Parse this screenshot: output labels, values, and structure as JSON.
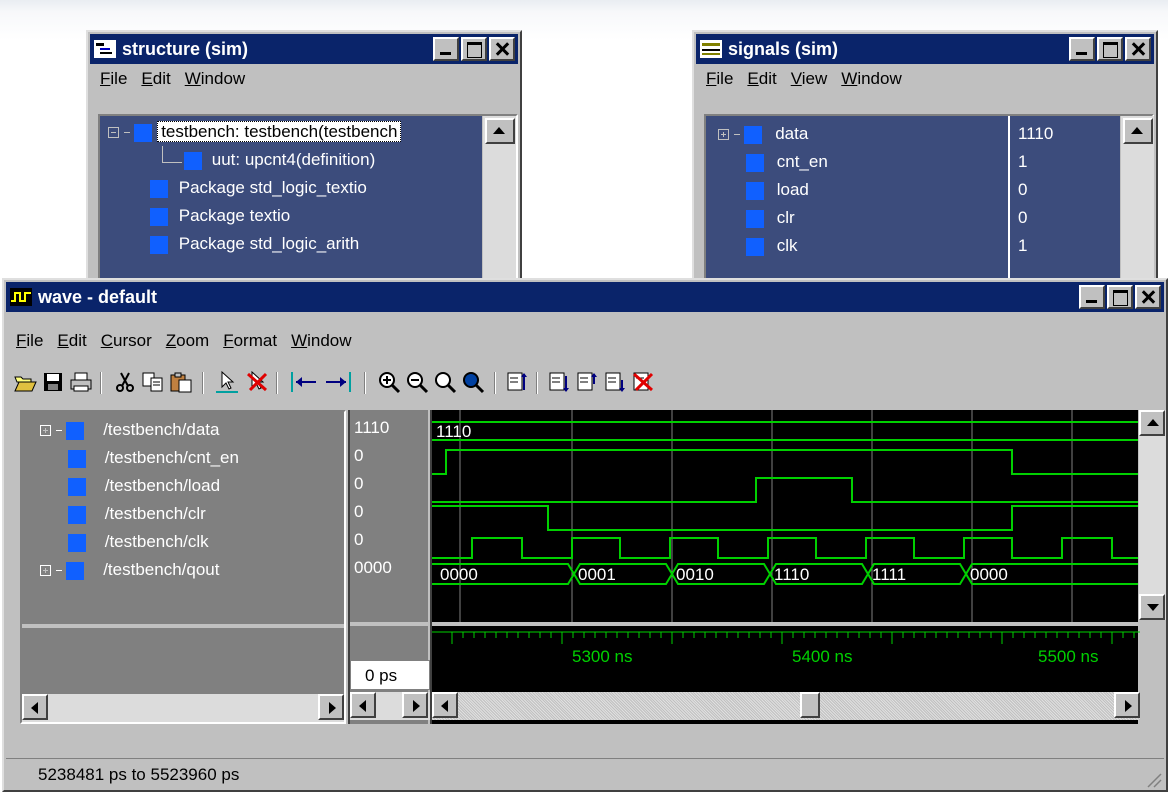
{
  "structure_window": {
    "title": "structure (sim)",
    "menu": [
      "File",
      "Edit",
      "Window"
    ],
    "tree": [
      {
        "label": "testbench: testbench(testbench",
        "expander": "minus"
      },
      {
        "label": "uut: upcnt4(definition)"
      },
      {
        "label": "Package std_logic_textio"
      },
      {
        "label": "Package textio"
      },
      {
        "label": "Package std_logic_arith"
      }
    ]
  },
  "signals_window": {
    "title": "signals (sim)",
    "menu": [
      "File",
      "Edit",
      "View",
      "Window"
    ],
    "signals": [
      {
        "name": "data",
        "value": "1110"
      },
      {
        "name": "cnt_en",
        "value": "1"
      },
      {
        "name": "load",
        "value": "0"
      },
      {
        "name": "clr",
        "value": "0"
      },
      {
        "name": "clk",
        "value": "1"
      }
    ]
  },
  "wave_window": {
    "title": "wave - default",
    "menu": [
      "File",
      "Edit",
      "Cursor",
      "Zoom",
      "Format",
      "Window"
    ],
    "signals": [
      {
        "path": "/testbench/data",
        "value": "1110"
      },
      {
        "path": "/testbench/cnt_en",
        "value": "0"
      },
      {
        "path": "/testbench/load",
        "value": "0"
      },
      {
        "path": "/testbench/clr",
        "value": "0"
      },
      {
        "path": "/testbench/clk",
        "value": "0"
      },
      {
        "path": "/testbench/qout",
        "value": "0000"
      }
    ],
    "bus_labels": {
      "data": [
        "1110"
      ],
      "qout": [
        "0000",
        "0001",
        "0010",
        "1110",
        "1111",
        "0000"
      ]
    },
    "time_ticks": [
      "5300 ns",
      "5400 ns",
      "5500 ns"
    ],
    "cursor_time": "0 ps",
    "status": "5238481 ps to 5523960 ps",
    "colors": {
      "waveform": "#00d000",
      "background": "#000000",
      "titlebar": "#0a246a",
      "signal_icon": "#1060ff"
    },
    "toolbar_icons": [
      "open-icon",
      "save-icon",
      "print-icon",
      "cut-icon",
      "copy-icon",
      "paste-icon",
      "select-pointer-icon",
      "delete-pointer-icon",
      "cursor-left-icon",
      "cursor-right-icon",
      "zoom-in-icon",
      "zoom-out-icon",
      "zoom-full-icon",
      "zoom-area-icon",
      "find-icon",
      "insert-divider-icon",
      "insert-above-icon",
      "insert-below-icon",
      "delete-signal-icon"
    ]
  }
}
